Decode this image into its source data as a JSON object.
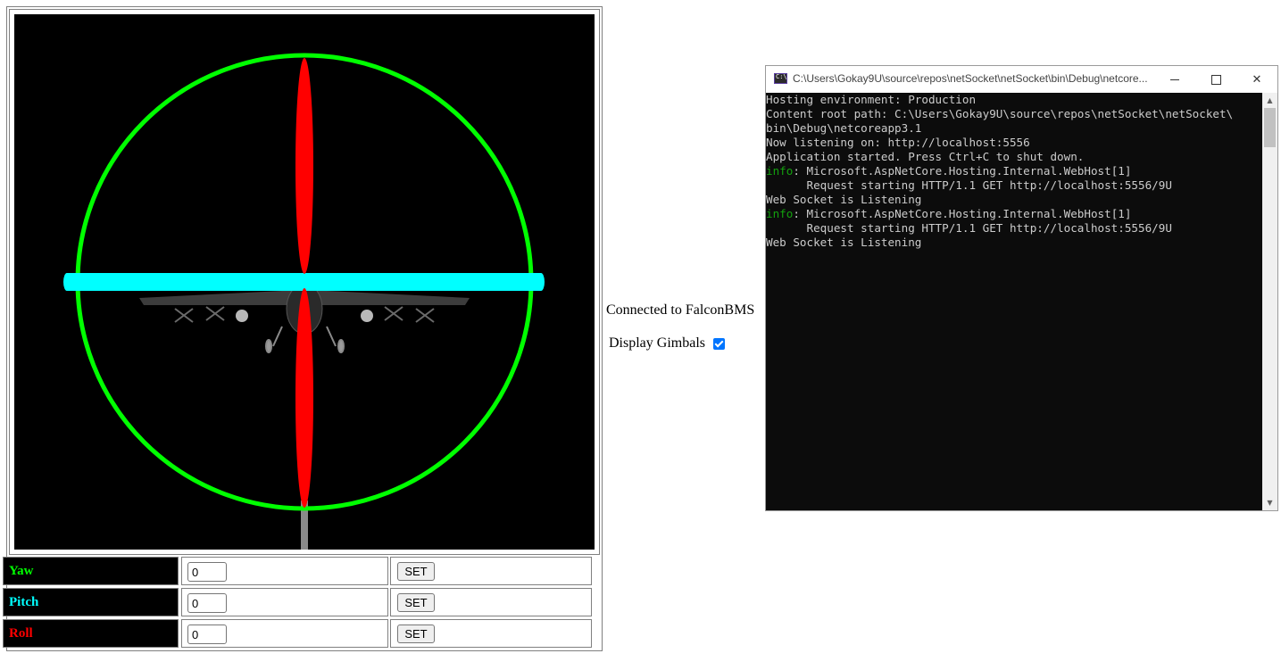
{
  "gimbals": {
    "colors": {
      "yaw": "#00ff00",
      "pitch": "#00ffff",
      "roll": "#ff0000"
    }
  },
  "controls": [
    {
      "label": "Yaw",
      "value": "0",
      "button": "SET",
      "color": "#00ff00"
    },
    {
      "label": "Pitch",
      "value": "0",
      "button": "SET",
      "color": "#00ffff"
    },
    {
      "label": "Roll",
      "value": "0",
      "button": "SET",
      "color": "#ff0000"
    }
  ],
  "status": "Connected to FalconBMS",
  "display_gimbals": {
    "label": "Display Gimbals",
    "checked": true
  },
  "console": {
    "title": "C:\\Users\\Gokay9U\\source\\repos\\netSocket\\netSocket\\bin\\Debug\\netcore...",
    "lines": [
      {
        "prefix": "",
        "text": "Hosting environment: Production"
      },
      {
        "prefix": "",
        "text": "Content root path: C:\\Users\\Gokay9U\\source\\repos\\netSocket\\netSocket\\"
      },
      {
        "prefix": "",
        "text": "bin\\Debug\\netcoreapp3.1"
      },
      {
        "prefix": "",
        "text": "Now listening on: http://localhost:5556"
      },
      {
        "prefix": "",
        "text": "Application started. Press Ctrl+C to shut down."
      },
      {
        "prefix": "info",
        "text": ": Microsoft.AspNetCore.Hosting.Internal.WebHost[1]"
      },
      {
        "prefix": "",
        "text": "      Request starting HTTP/1.1 GET http://localhost:5556/9U"
      },
      {
        "prefix": "",
        "text": "Web Socket is Listening"
      },
      {
        "prefix": "info",
        "text": ": Microsoft.AspNetCore.Hosting.Internal.WebHost[1]"
      },
      {
        "prefix": "",
        "text": "      Request starting HTTP/1.1 GET http://localhost:5556/9U"
      },
      {
        "prefix": "",
        "text": "Web Socket is Listening"
      }
    ]
  }
}
